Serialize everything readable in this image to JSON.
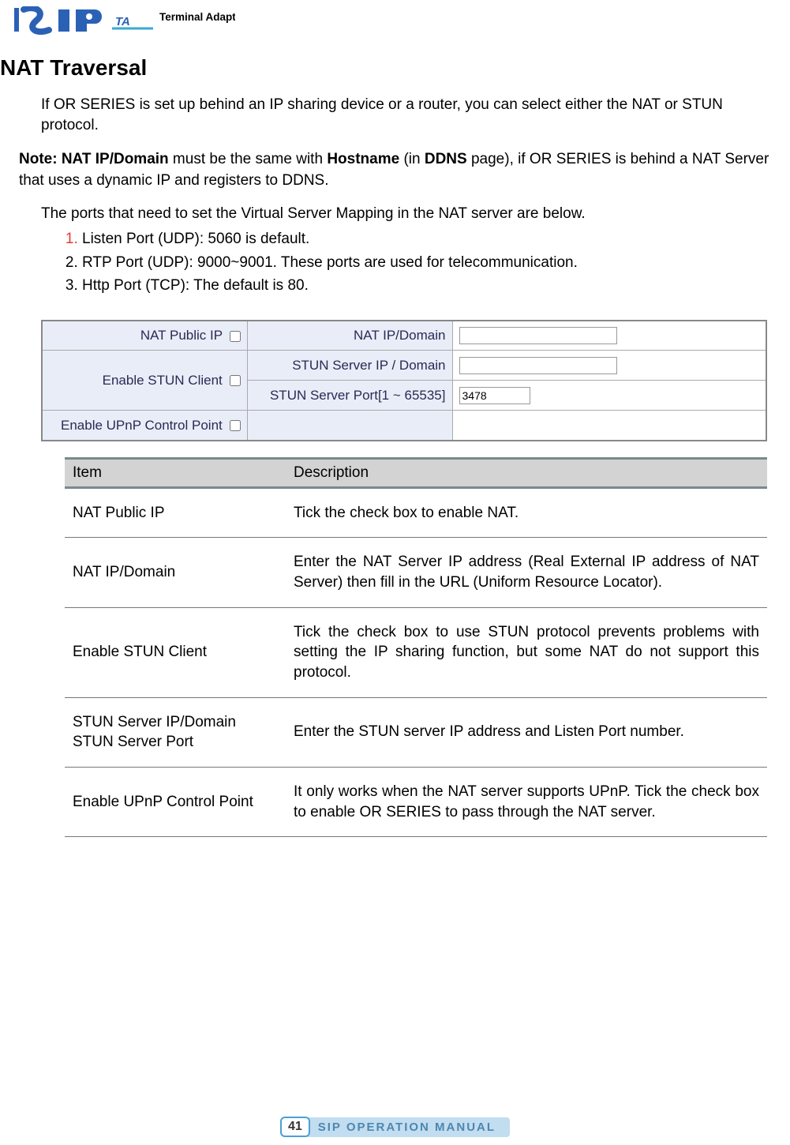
{
  "header": {
    "terminal_adapter": "Terminal Adapter"
  },
  "title": "NAT Traversal",
  "intro": "If OR SERIES is set up behind an IP sharing device or a router, you can select either the NAT or STUN protocol.",
  "note": {
    "prefix": "Note: NAT IP/Domain",
    "mid1": " must be the same with ",
    "hostname": "Hostname",
    "mid2": " (in ",
    "ddns": "DDNS",
    "rest": " page), if OR SERIES is behind a NAT Server that uses a dynamic IP and registers to DDNS."
  },
  "ports_intro": "The ports that need to set the Virtual Server Mapping in the NAT server are below.",
  "ports": [
    "Listen Port (UDP): 5060 is default.",
    "RTP Port (UDP): 9000~9001. These ports are used for telecommunication.",
    "Http Port (TCP): The default is 80."
  ],
  "form": {
    "nat_public_ip_label": "NAT Public IP",
    "nat_ip_domain_label": "NAT IP/Domain",
    "enable_stun_label": "Enable STUN Client",
    "stun_server_ip_label": "STUN Server IP / Domain",
    "stun_port_label": "STUN Server Port[1 ~ 65535]",
    "stun_port_value": "3478",
    "enable_upnp_label": "Enable UPnP Control Point"
  },
  "desc_table": {
    "headers": {
      "item": "Item",
      "desc": "Description"
    },
    "rows": [
      {
        "item": "NAT Public IP",
        "desc": "Tick the check box to enable NAT."
      },
      {
        "item": "NAT IP/Domain",
        "desc": "Enter the NAT Server IP address (Real External IP address of NAT Server) then fill in the URL (Uniform Resource Locator)."
      },
      {
        "item": "Enable STUN Client",
        "desc": "Tick the check box to use STUN protocol prevents problems with setting the IP sharing function, but some NAT do not support this protocol."
      },
      {
        "item": "STUN Server IP/Domain\nSTUN Server Port",
        "desc": "Enter the STUN server IP address and Listen Port number."
      },
      {
        "item": "Enable UPnP Control Point",
        "desc": "It only works when the NAT server supports UPnP. Tick the check box to enable OR SERIES to pass through the NAT server."
      }
    ]
  },
  "footer": {
    "page": "41",
    "manual": "SIP OPERATION MANUAL"
  }
}
